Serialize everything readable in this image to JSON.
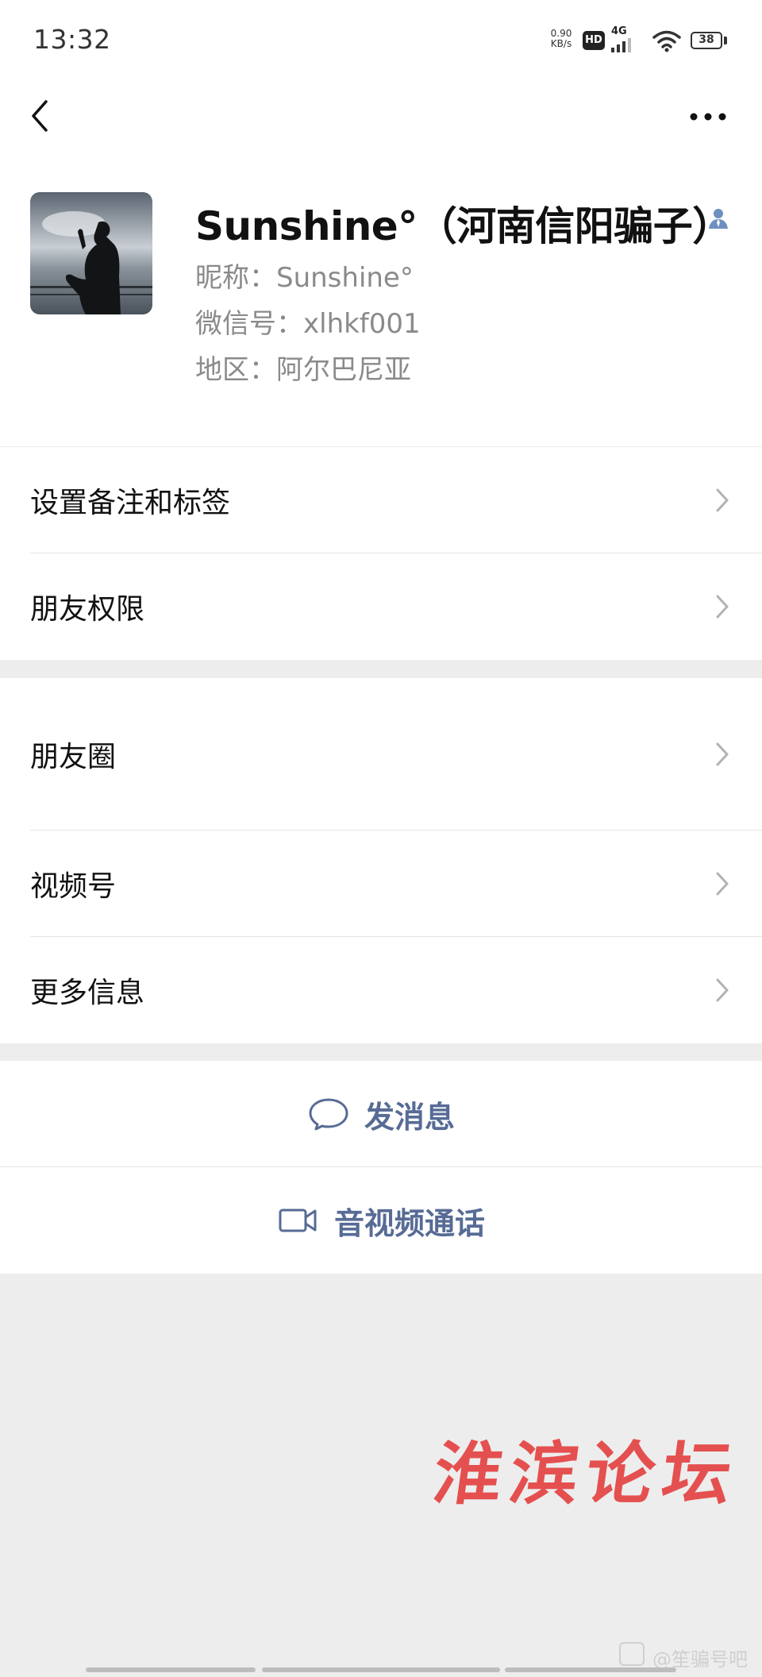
{
  "status_bar": {
    "time": "13:32",
    "net_speed_value": "0.90",
    "net_speed_unit": "KB/s",
    "hd_badge": "HD",
    "network": "4G",
    "battery": "38"
  },
  "nav": {
    "back_icon": "chevron-left-icon",
    "more_icon": "more-horizontal-icon"
  },
  "profile": {
    "name": "Sunshine°（河南信阳骗子）",
    "nickname": "昵称：Sunshine°",
    "wechat_id": "微信号：xlhkf001",
    "region": "地区：阿尔巴尼亚",
    "contact_icon": "contact-person-icon"
  },
  "settings_section": {
    "items": [
      {
        "label": "设置备注和标签"
      },
      {
        "label": "朋友权限"
      }
    ]
  },
  "info_section": {
    "items": [
      {
        "label": "朋友圈"
      },
      {
        "label": "视频号"
      },
      {
        "label": "更多信息"
      }
    ]
  },
  "actions": {
    "message_label": "发消息",
    "call_label": "音视频通话"
  },
  "watermark": {
    "text": "淮滨论坛",
    "corner_text": "@笙骗号吧"
  },
  "colors": {
    "link_blue": "#576b95",
    "background": "#ededed",
    "watermark_red": "#e4504f"
  }
}
